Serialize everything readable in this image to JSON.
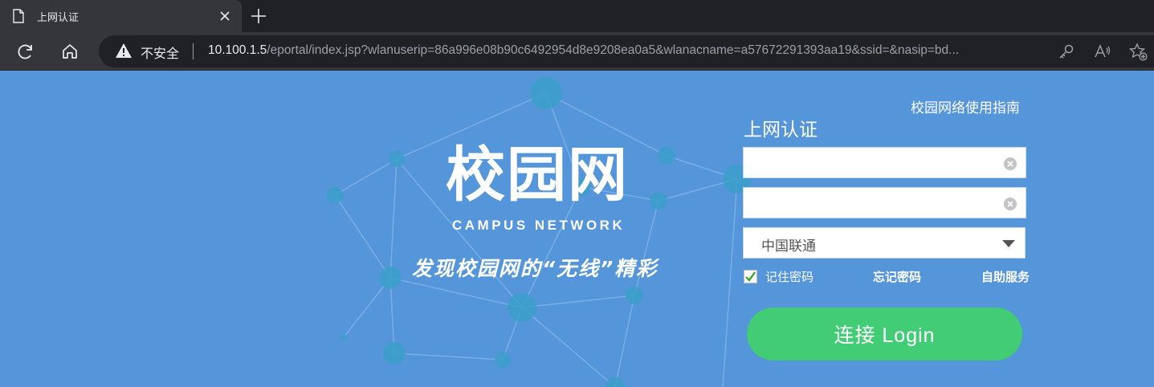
{
  "browser": {
    "tab_title": "上网认证",
    "new_tab_symbol": "+",
    "security_label": "不安全",
    "url_host": "10.100.1.5",
    "url_rest": "/eportal/index.jsp?wlanuserip=86a996e08b90c6492954d8e9208ea0a5&wlanacname=a57672291393aa19&ssid=&nasip=bd..."
  },
  "hero": {
    "title": "校园网",
    "subtitle": "CAMPUS NETWORK",
    "slogan": "发现校园网的“无线”精彩"
  },
  "form": {
    "guide_link": "校园网络使用指南",
    "title": "上网认证",
    "username_value": "",
    "password_value": "",
    "isp_selected": "中国联通",
    "remember_label": "记住密码",
    "remember_checked": true,
    "forgot_label": "忘记密码",
    "self_service_label": "自助服务",
    "login_label": "连接 Login"
  },
  "colors": {
    "page_bg": "#5595d9",
    "login_btn": "#42cc75",
    "chrome_dark": "#202124",
    "chrome_toolbar": "#35363a"
  }
}
